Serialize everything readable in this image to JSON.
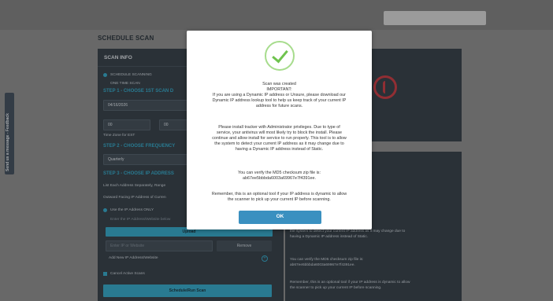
{
  "page": {
    "title": "SCHEDULE SCAN"
  },
  "feedback_tab": {
    "label": "Send us a message - Feedback"
  },
  "scan_info": {
    "header": "SCAN INFO",
    "schedule_option": "SCHEDULE SCANNING",
    "one_time_option": "ONE TIME SCAN",
    "step1": "STEP 1 - CHOOSE 1ST SCAN D",
    "date_value": "04/16/2026",
    "hour_value": "00",
    "minute_value": "00",
    "timezone_label": "Time Zone for EST",
    "step2": "STEP 2 - CHOOSE FREQUENCY",
    "frequency_value": "Quarterly",
    "step3": "STEP 3 - CHOOSE IP ADDRESS",
    "list_hint": "List Each Address Separately, Range",
    "outward_hint": "Outward Facing IP Address of Curren",
    "use_ip_option": "Use the IP Address ONLY",
    "enter_hint": "Enter the IP Address/Website below",
    "upload_label": "Upload",
    "ip_placeholder": "Enter IP or Website",
    "remove_label": "Remove",
    "add_new_label": "Add New IP Address/Website",
    "cancel_active_label": "Cancel Active Scans",
    "schedule_button": "Schedule/Run Scan"
  },
  "right_panel": {
    "lines": [
      "or Unsure, please download our",
      "elp us keep track of your current IP",
      "",
      "ator privileges. Due to type of",
      "ry to block the install. Please",
      "o run properly. This tool is to allow",
      "the system to detect your current IP address as it may change due to",
      "having a Dynamic IP address instead of Static.",
      "",
      "You can verify the MD5 checksum zip file is:",
      "ab67ee5bbbda6003a69967e7f4391ee.",
      "",
      "Remember, this is an optional tool if your IP address is dynamic to allow",
      "the scanner to pick up your current IP before scanning."
    ]
  },
  "modal": {
    "icon": "check-circle-icon",
    "lines": [
      "Scan was created",
      "IMPORTANT:",
      "If you are using a Dynamic IP address or Unsure, please download our",
      "Dynamic IP address lookup tool to help us keep track of your current IP",
      "address for future scans.",
      "",
      "Please install tracker with Administrator privileges. Due to type of",
      "service, your antivirus will most likely try to block the install. Please",
      "continue and allow install for service to run properly. This tool is to allow",
      "the system to detect your current IP address as it may change due to",
      "having a Dynamic IP address instead of Static.",
      "",
      "You can verify the MD5 checksum zip file is:",
      "ab67ee5bbbda6003a69967e7f4391ee.",
      "",
      "Remember, this is an optional tool if your IP address is dynamic to allow",
      "the scanner to pick up your current IP before scanning."
    ],
    "ok_label": "OK"
  },
  "colors": {
    "accent": "#2aa7c9",
    "ok_button": "#3a90c0",
    "success": "#6fc34e",
    "card": "#2b3640"
  }
}
